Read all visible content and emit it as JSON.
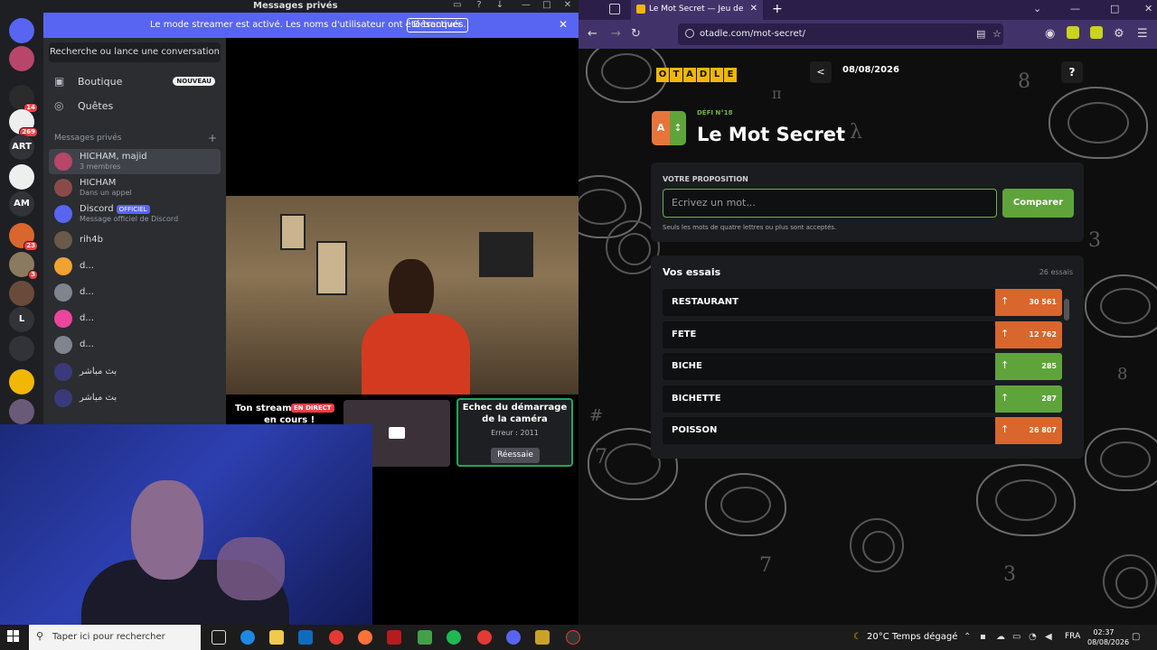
{
  "discord": {
    "window_title": "Messages privés",
    "window_controls": [
      "—",
      "□",
      "✕"
    ],
    "banner": {
      "message": "Le mode streamer est activé. Les noms d'utilisateur ont été tronqués.",
      "button": "Désactiver",
      "close": "✕"
    },
    "servers": [
      {
        "label": "",
        "badge": ""
      },
      {
        "label": "",
        "badge": ""
      },
      {
        "label": "",
        "badge": "14"
      },
      {
        "label": "",
        "badge": "269"
      },
      {
        "label": "ART",
        "badge": ""
      },
      {
        "label": "",
        "badge": ""
      },
      {
        "label": "AM",
        "badge": ""
      },
      {
        "label": "",
        "badge": "23"
      },
      {
        "label": "",
        "badge": "3"
      },
      {
        "label": "",
        "badge": ""
      },
      {
        "label": "L",
        "badge": ""
      },
      {
        "label": "",
        "badge": ""
      },
      {
        "label": "",
        "badge": ""
      },
      {
        "label": "",
        "badge": ""
      }
    ],
    "search_placeholder": "Recherche ou lance une conversation",
    "nav": {
      "shop": "Boutique",
      "shop_badge": "NOUVEAU",
      "quests": "Quêtes"
    },
    "dm_header": "Messages privés",
    "dm_add": "+",
    "dms": [
      {
        "name": "HICHAM, majid",
        "sub": "3 membres",
        "tag": "",
        "color": "#b7466a"
      },
      {
        "name": "HICHAM",
        "sub": "Dans un appel",
        "tag": "",
        "color": "#8a4a4a"
      },
      {
        "name": "Discord",
        "sub": "Message officiel de Discord",
        "tag": "OFFICIEL",
        "color": "#5865f2"
      },
      {
        "name": "rih4b",
        "sub": "",
        "tag": "",
        "color": "#6a5a4a"
      },
      {
        "name": "d...",
        "sub": "",
        "tag": "",
        "color": "#f0a232"
      },
      {
        "name": "d...",
        "sub": "",
        "tag": "",
        "color": "#80848e"
      },
      {
        "name": "d...",
        "sub": "",
        "tag": "",
        "color": "#eb459e"
      },
      {
        "name": "d...",
        "sub": "",
        "tag": "",
        "color": "#80848e"
      },
      {
        "name": "بث مباشر",
        "sub": "",
        "tag": "",
        "color": "#3a3a7a"
      },
      {
        "name": "بث مباشر",
        "sub": "",
        "tag": "",
        "color": "#3a3a7a"
      }
    ],
    "stream_tile": {
      "line1": "Ton stream e",
      "live": "EN DIRECT",
      "line2": "en cours !"
    },
    "error_tile": {
      "title": "Echec du démarrage de la caméra",
      "error": "Erreur : 2011",
      "retry": "Réessaie"
    }
  },
  "browser": {
    "tab_title": "Le Mot Secret — Jeu de lettres",
    "tab_close": "✕",
    "new_tab": "+",
    "url": "otadle.com/mot-secret/",
    "window_controls": [
      "⌄",
      "—",
      "□",
      "✕"
    ]
  },
  "game": {
    "logo_letters": [
      "O",
      "T",
      "A",
      "D",
      "L",
      "E"
    ],
    "back": "<",
    "date": "08/08/2026",
    "help": "?",
    "icon_left": "A",
    "icon_right": "↕",
    "defi": "DÉFI N°18",
    "title": "Le Mot Secret",
    "proposal_label": "VOTRE PROPOSITION",
    "input_placeholder": "Ecrivez un mot...",
    "compare_button": "Comparer",
    "hint": "Seuls les mots de quatre lettres ou plus sont acceptés.",
    "guesses_title": "Vos essais",
    "guesses_count": "26 essais",
    "guesses": [
      {
        "word": "RESTAURANT",
        "score": "30 561",
        "arrow": "↑",
        "color": "#d9662c"
      },
      {
        "word": "FETE",
        "score": "12 762",
        "arrow": "↑",
        "color": "#d9662c"
      },
      {
        "word": "BICHE",
        "score": "285",
        "arrow": "↑",
        "color": "#5fa43a"
      },
      {
        "word": "BICHETTE",
        "score": "287",
        "arrow": "↑",
        "color": "#5fa43a"
      },
      {
        "word": "POISSON",
        "score": "26 807",
        "arrow": "↑",
        "color": "#d9662c"
      }
    ]
  },
  "taskbar": {
    "search_placeholder": "Taper ici pour rechercher",
    "weather": "20°C  Temps dégagé",
    "lang": "FRA",
    "time": "02:37",
    "date": "08/08/2026"
  }
}
